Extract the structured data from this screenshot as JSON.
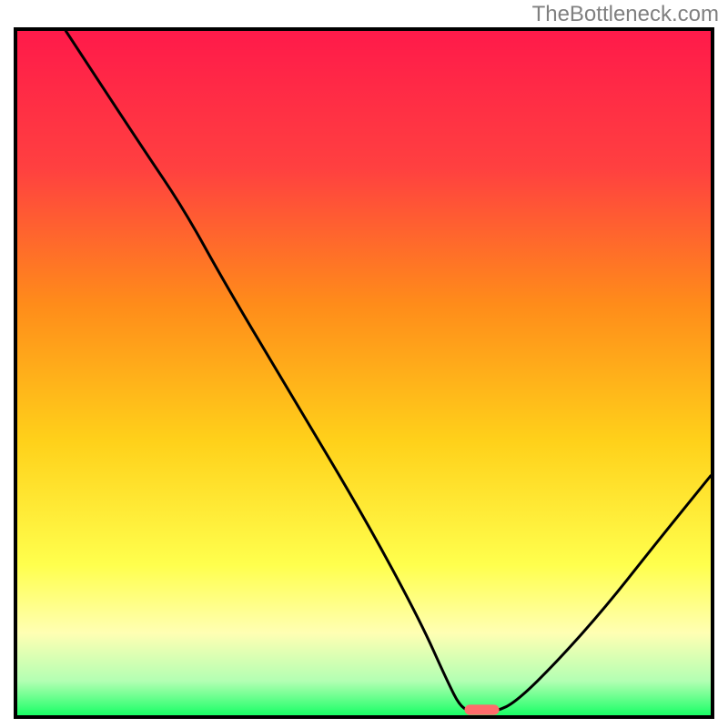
{
  "watermark": "TheBottleneck.com",
  "chart_data": {
    "type": "line",
    "title": "",
    "xlabel": "",
    "ylabel": "",
    "xlim": [
      0,
      100
    ],
    "ylim": [
      0,
      100
    ],
    "gradient_stops": [
      {
        "offset": 0,
        "color": "#ff1a4a"
      },
      {
        "offset": 20,
        "color": "#ff4040"
      },
      {
        "offset": 40,
        "color": "#ff8c1a"
      },
      {
        "offset": 60,
        "color": "#ffd11a"
      },
      {
        "offset": 78,
        "color": "#ffff4d"
      },
      {
        "offset": 88,
        "color": "#ffffb3"
      },
      {
        "offset": 95,
        "color": "#b3ffb3"
      },
      {
        "offset": 100,
        "color": "#1aff66"
      }
    ],
    "curve": {
      "description": "Bottleneck percentage curve; descends from top-left to a trough near x≈66–68 at y≈0, then rises to ~33 at x=100",
      "points": [
        {
          "x": 7,
          "y": 100
        },
        {
          "x": 18,
          "y": 83
        },
        {
          "x": 24,
          "y": 74
        },
        {
          "x": 30,
          "y": 63
        },
        {
          "x": 40,
          "y": 46
        },
        {
          "x": 50,
          "y": 29
        },
        {
          "x": 58,
          "y": 14
        },
        {
          "x": 62,
          "y": 5
        },
        {
          "x": 64,
          "y": 1
        },
        {
          "x": 66,
          "y": 0.5
        },
        {
          "x": 69,
          "y": 0.5
        },
        {
          "x": 72,
          "y": 2
        },
        {
          "x": 78,
          "y": 8
        },
        {
          "x": 85,
          "y": 16
        },
        {
          "x": 92,
          "y": 25
        },
        {
          "x": 100,
          "y": 35
        }
      ]
    },
    "marker": {
      "description": "Current configuration indicator (pink lozenge at the trough)",
      "x": 67,
      "y": 0.8,
      "width": 5,
      "height": 1.5,
      "color": "#ff6b6b"
    }
  }
}
